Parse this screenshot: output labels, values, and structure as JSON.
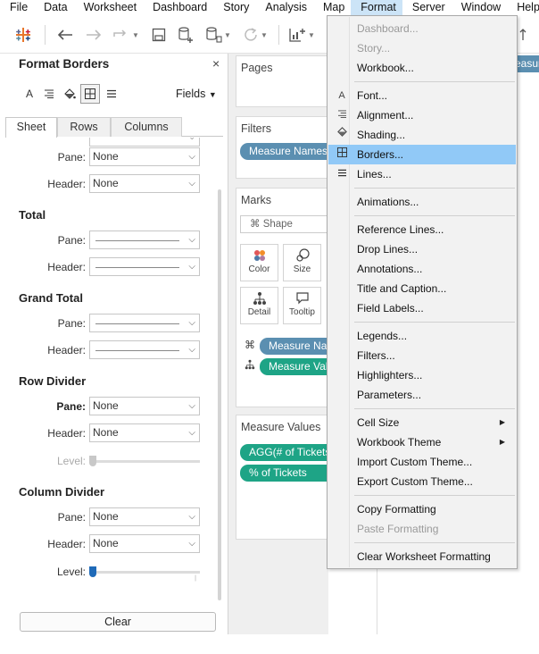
{
  "menubar": [
    "File",
    "Data",
    "Worksheet",
    "Dashboard",
    "Story",
    "Analysis",
    "Map",
    "Format",
    "Server",
    "Window",
    "Help"
  ],
  "active_menu": "Format",
  "format_panel": {
    "title": "Format Borders",
    "close": "×",
    "fields_label": "Fields",
    "tabs": [
      "Sheet",
      "Rows",
      "Columns"
    ],
    "active_tab": "Sheet",
    "partial_rows": [
      {
        "label": "Pane:",
        "value": "None"
      },
      {
        "label": "Header:",
        "value": "None"
      }
    ],
    "total": {
      "title": "Total",
      "pane_label": "Pane:",
      "header_label": "Header:"
    },
    "grand_total": {
      "title": "Grand Total",
      "pane_label": "Pane:",
      "header_label": "Header:"
    },
    "row_divider": {
      "title": "Row Divider",
      "pane_label": "Pane:",
      "pane_value": "None",
      "header_label": "Header:",
      "header_value": "None",
      "level_label": "Level:",
      "level_fraction": 0.0
    },
    "column_divider": {
      "title": "Column Divider",
      "pane_label": "Pane:",
      "pane_value": "None",
      "header_label": "Header:",
      "header_value": "None",
      "level_label": "Level:",
      "level_fraction": 0.0
    },
    "clear_label": "Clear"
  },
  "cards": {
    "pages": "Pages",
    "filters": "Filters",
    "filter_pill": "Measure Names",
    "marks": "Marks",
    "mark_type": "Shape",
    "mark_buttons": [
      "Color",
      "Size",
      "Detail",
      "Tooltip"
    ],
    "marks_pills": [
      "Measure Names",
      "Measure Values"
    ],
    "measure_values": "Measure Values",
    "mv_pills": [
      "AGG(# of Tickets)",
      "% of Tickets"
    ]
  },
  "canvas_measure_tab": "Measure",
  "format_menu": [
    {
      "label": "Dashboard...",
      "disabled": true
    },
    {
      "label": "Story...",
      "disabled": true
    },
    {
      "label": "Workbook...",
      "disabled": false
    },
    {
      "sep": true
    },
    {
      "label": "Font...",
      "icon": "font-icon"
    },
    {
      "label": "Alignment...",
      "icon": "alignment-icon"
    },
    {
      "label": "Shading...",
      "icon": "shading-icon"
    },
    {
      "label": "Borders...",
      "icon": "borders-icon",
      "highlight": true
    },
    {
      "label": "Lines...",
      "icon": "lines-icon"
    },
    {
      "sep": true
    },
    {
      "label": "Animations..."
    },
    {
      "sep": true
    },
    {
      "label": "Reference Lines..."
    },
    {
      "label": "Drop Lines..."
    },
    {
      "label": "Annotations..."
    },
    {
      "label": "Title and Caption..."
    },
    {
      "label": "Field Labels..."
    },
    {
      "sep": true
    },
    {
      "label": "Legends..."
    },
    {
      "label": "Filters..."
    },
    {
      "label": "Highlighters..."
    },
    {
      "label": "Parameters..."
    },
    {
      "sep": true
    },
    {
      "label": "Cell Size",
      "submenu": true
    },
    {
      "label": "Workbook Theme",
      "submenu": true
    },
    {
      "label": "Import Custom Theme..."
    },
    {
      "label": "Export Custom Theme..."
    },
    {
      "sep": true
    },
    {
      "label": "Copy Formatting"
    },
    {
      "label": "Paste Formatting",
      "disabled": true
    },
    {
      "sep": true
    },
    {
      "label": "Clear Worksheet Formatting"
    }
  ],
  "colors": {
    "menu_highlight": "#91c9f7",
    "blue_pill": "#5b8fb1",
    "green_pill": "#1ea486",
    "slider_active": "#1f6ab8"
  }
}
